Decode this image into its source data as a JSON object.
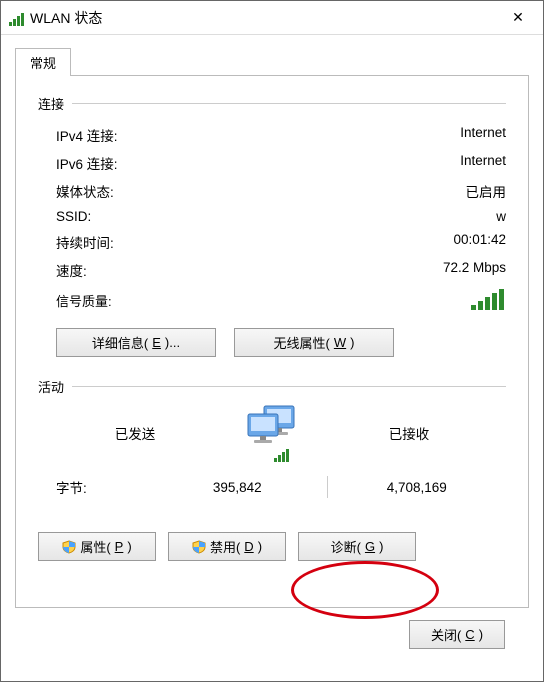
{
  "window": {
    "title": "WLAN 状态",
    "close_symbol": "✕"
  },
  "tab": {
    "general": "常规"
  },
  "groups": {
    "connection": "连接",
    "activity": "活动"
  },
  "connection": {
    "ipv4_label": "IPv4 连接:",
    "ipv4_value": "Internet",
    "ipv6_label": "IPv6 连接:",
    "ipv6_value": "Internet",
    "media_label": "媒体状态:",
    "media_value": "已启用",
    "ssid_label": "SSID:",
    "ssid_value": "w",
    "duration_label": "持续时间:",
    "duration_value": "00:01:42",
    "speed_label": "速度:",
    "speed_value": "72.2 Mbps",
    "signal_label": "信号质量:"
  },
  "buttons": {
    "details_pre": "详细信息(",
    "details_key": "E",
    "details_post": ")...",
    "wireless_pre": "无线属性(",
    "wireless_key": "W",
    "wireless_post": ")",
    "properties_pre": "属性(",
    "properties_key": "P",
    "properties_post": ")",
    "disable_pre": "禁用(",
    "disable_key": "D",
    "disable_post": ")",
    "diagnose_pre": "诊断(",
    "diagnose_key": "G",
    "diagnose_post": ")",
    "close_pre": "关闭(",
    "close_key": "C",
    "close_post": ")"
  },
  "activity": {
    "sent_label": "已发送",
    "received_label": "已接收",
    "bytes_label": "字节:",
    "sent_value": "395,842",
    "received_value": "4,708,169"
  }
}
